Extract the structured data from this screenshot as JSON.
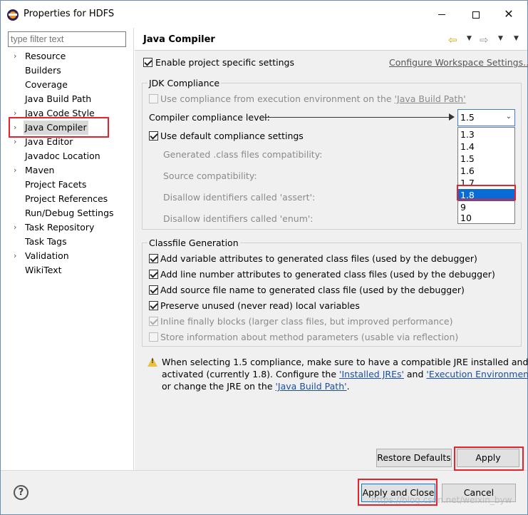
{
  "window": {
    "title": "Properties for HDFS"
  },
  "left": {
    "filter_placeholder": "type filter text",
    "tree": [
      {
        "label": "Resource",
        "expandable": true
      },
      {
        "label": "Builders",
        "expandable": false
      },
      {
        "label": "Coverage",
        "expandable": false
      },
      {
        "label": "Java Build Path",
        "expandable": false
      },
      {
        "label": "Java Code Style",
        "expandable": true
      },
      {
        "label": "Java Compiler",
        "expandable": true,
        "selected": true
      },
      {
        "label": "Java Editor",
        "expandable": true
      },
      {
        "label": "Javadoc Location",
        "expandable": false
      },
      {
        "label": "Maven",
        "expandable": true
      },
      {
        "label": "Project Facets",
        "expandable": false
      },
      {
        "label": "Project References",
        "expandable": false
      },
      {
        "label": "Run/Debug Settings",
        "expandable": false
      },
      {
        "label": "Task Repository",
        "expandable": true
      },
      {
        "label": "Task Tags",
        "expandable": false
      },
      {
        "label": "Validation",
        "expandable": true
      },
      {
        "label": "WikiText",
        "expandable": false
      }
    ]
  },
  "right": {
    "title": "Java Compiler",
    "enable_project_specific": "Enable project specific settings",
    "configure_workspace": "Configure Workspace Settings...",
    "jdk": {
      "group_title": "JDK Compliance",
      "use_compliance_prefix": "Use compliance from execution environment on the ",
      "use_compliance_link": "'Java Build Path'",
      "compliance_level_label": "Compiler compliance level:",
      "compliance_level_value": "1.5",
      "options": [
        "1.3",
        "1.4",
        "1.5",
        "1.6",
        "1.7",
        "1.8",
        "9",
        "10"
      ],
      "highlighted_option": "1.8",
      "use_default": "Use default compliance settings",
      "generated_class": "Generated .class files compatibility:",
      "source_compat": "Source compatibility:",
      "disallow_assert": "Disallow identifiers called 'assert':",
      "disallow_enum": "Disallow identifiers called 'enum':"
    },
    "classfile": {
      "group_title": "Classfile Generation",
      "items": [
        {
          "label": "Add variable attributes to generated class files (used by the debugger)",
          "checked": true,
          "enabled": true
        },
        {
          "label": "Add line number attributes to generated class files (used by the debugger)",
          "checked": true,
          "enabled": true
        },
        {
          "label": "Add source file name to generated class file (used by the debugger)",
          "checked": true,
          "enabled": true
        },
        {
          "label": "Preserve unused (never read) local variables",
          "checked": true,
          "enabled": true
        },
        {
          "label": "Inline finally blocks (larger class files, but improved performance)",
          "checked": true,
          "enabled": false
        },
        {
          "label": "Store information about method parameters (usable via reflection)",
          "checked": false,
          "enabled": false
        }
      ]
    },
    "warning": {
      "line1": "When selecting 1.5 compliance, make sure to have a compatible JRE installed and",
      "line2_prefix": "activated (currently 1.8). Configure the ",
      "installed_jres": "'Installed JREs'",
      "and": " and ",
      "exec_envs": "'Execution Environments'",
      "comma": ",",
      "line3_prefix": "or change the JRE on the ",
      "java_build_path": "'Java Build Path'",
      "period": "."
    },
    "restore_defaults": "Restore Defaults",
    "apply": "Apply"
  },
  "bottom": {
    "help": "?",
    "apply_and_close": "Apply and Close",
    "cancel": "Cancel",
    "watermark": "https://blog.csdn.net/weixin_byw"
  },
  "colors": {
    "highlight_box": "#e8222c",
    "selection": "#0a6bd6",
    "link": "#1a4fa0"
  }
}
